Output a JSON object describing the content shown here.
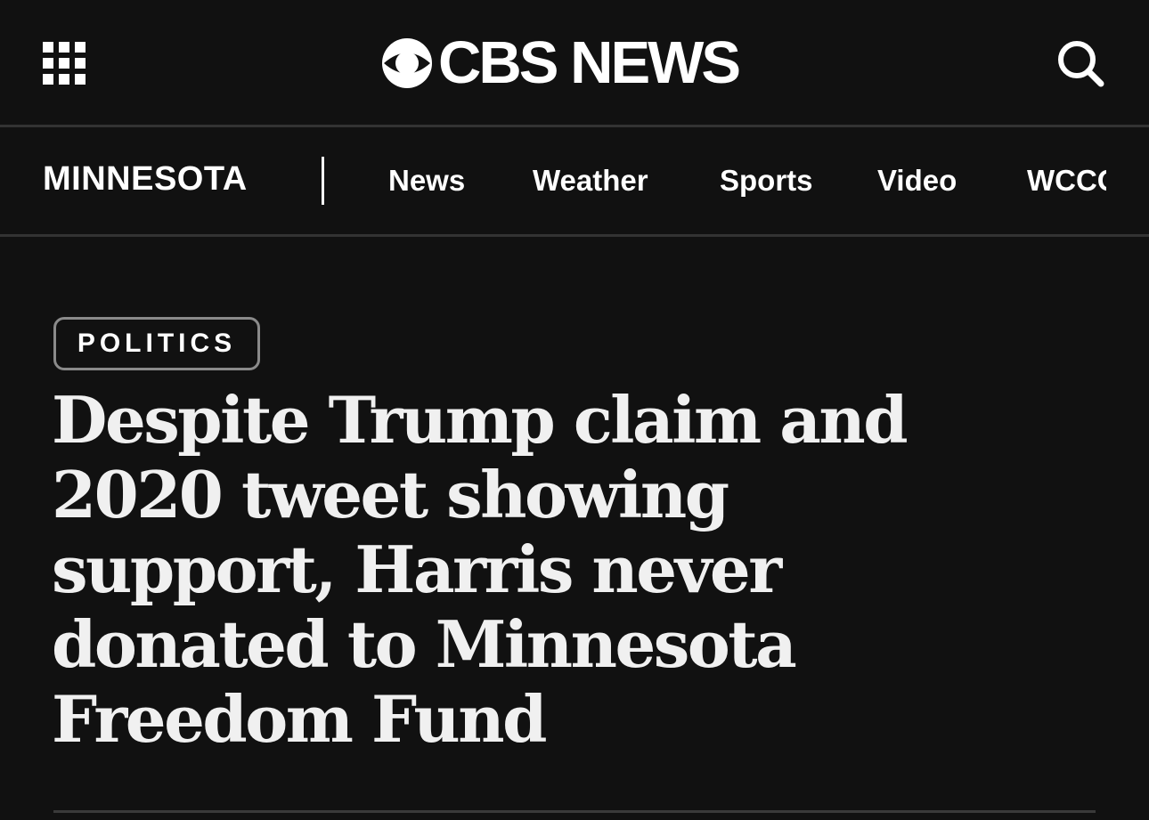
{
  "header": {
    "logo_text": "CBS NEWS",
    "menu_icon": "grid-menu-icon",
    "search_icon": "search-icon"
  },
  "subnav": {
    "section": "MINNESOTA",
    "links": [
      "News",
      "Weather",
      "Sports",
      "Video",
      "WCCO"
    ]
  },
  "article": {
    "category": "POLITICS",
    "headline_lines": [
      "Despite Trump claim and",
      "2020 tweet showing",
      "support, Harris never",
      "donated to Minnesota",
      "Freedom Fund"
    ]
  },
  "colors": {
    "background": "#111111",
    "text": "#ffffff",
    "divider": "#333333",
    "pill_border": "#8a8a8a"
  }
}
